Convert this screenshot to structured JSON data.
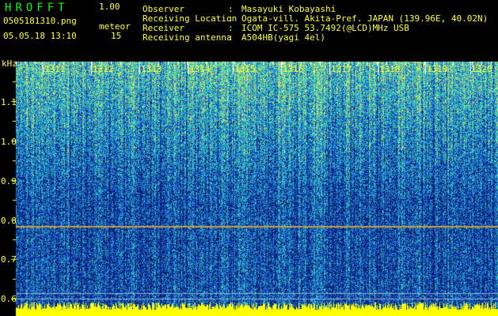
{
  "header": {
    "app_title": "HROFFT",
    "version": "1.00",
    "filename": "0505181310.png",
    "datetime": "05.05.18 13:10",
    "meteor_label": "meteor",
    "meteor_count": "15",
    "observer_label": "Observer",
    "observer_value": "Masayuki Kobayashi",
    "location_label": "Receiving Location",
    "location_value": "Ogata-vill. Akita-Pref. JAPAN (139.96E, 40.02N)",
    "receiver_label": "Receiver",
    "receiver_value": "ICOM IC-575 53.7492(@LCD)MHz USB",
    "antenna_label": "Receiving antenna",
    "antenna_value": "A504HB(yagi 4el)",
    "separator": ":"
  },
  "spectrogram": {
    "unit_label": "kHz",
    "y_ticks": [
      "1.1",
      "1.0",
      "0.9",
      "0.8",
      "0.7",
      "0.6"
    ],
    "time_labels": [
      "1311",
      "1312",
      "1313",
      "1314",
      "1315",
      "1316",
      "1317",
      "1318",
      "1319",
      "1320"
    ],
    "colors": {
      "background": "#0a1f7a",
      "mid": "#1f6bd0",
      "high": "#3fe0c0",
      "peak": "#e8f060",
      "baseline": "#ffff00",
      "axis": "#ffff33"
    }
  }
}
